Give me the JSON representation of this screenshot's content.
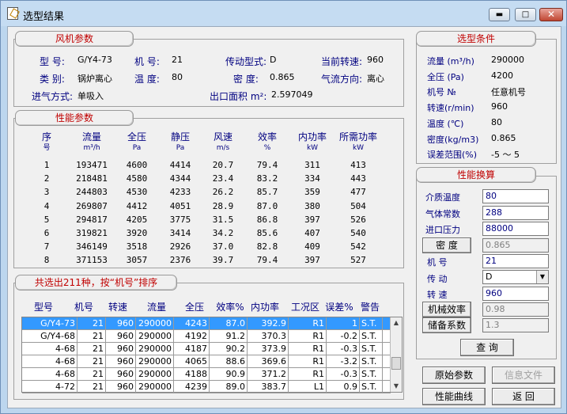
{
  "window": {
    "title": "选型结果",
    "minimize": "▬",
    "maximize": "□",
    "close": "✕"
  },
  "fan_params": {
    "title": "风机参数",
    "rows": [
      [
        {
          "label": "型  号:",
          "value": "G/Y4-73"
        },
        {
          "label": "机  号:",
          "value": "21"
        },
        {
          "label": "传动型式:",
          "value": "D"
        },
        {
          "label": "当前转速:",
          "value": "960"
        }
      ],
      [
        {
          "label": "类  别:",
          "value": "锅炉离心"
        },
        {
          "label": "温  度:",
          "value": "80"
        },
        {
          "label": "密  度:",
          "value": "0.865"
        },
        {
          "label": "气流方向:",
          "value": "离心"
        }
      ],
      [
        {
          "label": "进气方式:",
          "value": "单吸入"
        },
        {
          "label": "出口面积 m²:",
          "value": "2.597049"
        }
      ]
    ]
  },
  "perf_params": {
    "title": "性能参数",
    "headers": [
      [
        "序",
        "号"
      ],
      [
        "流量",
        "m³/h"
      ],
      [
        "全压",
        "Pa"
      ],
      [
        "静压",
        "Pa"
      ],
      [
        "风速",
        "m/s"
      ],
      [
        "效率",
        "%"
      ],
      [
        "内功率",
        "kW"
      ],
      [
        "所需功率",
        "kW"
      ]
    ],
    "rows": [
      [
        "1",
        "193471",
        "4600",
        "4414",
        "20.7",
        "79.4",
        "311",
        "413"
      ],
      [
        "2",
        "218481",
        "4580",
        "4344",
        "23.4",
        "83.2",
        "334",
        "443"
      ],
      [
        "3",
        "244803",
        "4530",
        "4233",
        "26.2",
        "85.7",
        "359",
        "477"
      ],
      [
        "4",
        "269807",
        "4412",
        "4051",
        "28.9",
        "87.0",
        "380",
        "504"
      ],
      [
        "5",
        "294817",
        "4205",
        "3775",
        "31.5",
        "86.8",
        "397",
        "526"
      ],
      [
        "6",
        "319821",
        "3920",
        "3414",
        "34.2",
        "85.6",
        "407",
        "540"
      ],
      [
        "7",
        "346149",
        "3518",
        "2926",
        "37.0",
        "82.8",
        "409",
        "542"
      ],
      [
        "8",
        "371153",
        "3057",
        "2376",
        "39.7",
        "79.4",
        "397",
        "527"
      ]
    ]
  },
  "results": {
    "title": "共选出211种，按“机号”排序",
    "headers": [
      "型号",
      "机号",
      "转速",
      "流量",
      "全压",
      "效率%",
      "内功率",
      "工况区",
      "误差%",
      "警告"
    ],
    "rows": [
      [
        "G/Y4-73",
        "21",
        "960",
        "290000",
        "4243",
        "87.0",
        "392.9",
        "R1",
        "1",
        "S.T."
      ],
      [
        "G/Y4-68",
        "21",
        "960",
        "290000",
        "4192",
        "91.2",
        "370.3",
        "R1",
        "-0.2",
        "S.T."
      ],
      [
        "4-68",
        "21",
        "960",
        "290000",
        "4187",
        "90.2",
        "373.9",
        "R1",
        "-0.3",
        "S.T."
      ],
      [
        "4-68",
        "21",
        "960",
        "290000",
        "4065",
        "88.6",
        "369.6",
        "R1",
        "-3.2",
        "S.T."
      ],
      [
        "4-68",
        "21",
        "960",
        "290000",
        "4188",
        "90.9",
        "371.2",
        "R1",
        "-0.3",
        "S.T."
      ],
      [
        "4-72",
        "21",
        "960",
        "290000",
        "4239",
        "89.0",
        "383.7",
        "L1",
        "0.9",
        "S.T."
      ]
    ]
  },
  "conditions": {
    "title": "选型条件",
    "rows": [
      {
        "label": "流量 (m³/h)",
        "value": "290000"
      },
      {
        "label": "全压  (Pa)",
        "value": "4200"
      },
      {
        "label": "机号    №",
        "value": "任意机号"
      },
      {
        "label": "转速(r/min)",
        "value": "960"
      },
      {
        "label": "温度  (℃)",
        "value": "80"
      },
      {
        "label": "密度(kg/m3)",
        "value": "0.865"
      },
      {
        "label": "误差范围(%)",
        "value": "-5 ～ 5"
      }
    ]
  },
  "conversion": {
    "title": "性能换算",
    "medium_temp": {
      "label": "介质温度",
      "value": "80"
    },
    "gas_const": {
      "label": "气体常数",
      "value": "288"
    },
    "inlet_pressure": {
      "label": "进口压力",
      "value": "88000"
    },
    "density": {
      "label": "密  度",
      "value": "0.865"
    },
    "machine_no": {
      "label": "机    号",
      "value": "21"
    },
    "drive": {
      "label": "传    动",
      "value": "D"
    },
    "speed": {
      "label": "转    速",
      "value": "960"
    },
    "mech_eff": {
      "label": "机械效率",
      "value": "0.98"
    },
    "reserve": {
      "label": "储备系数",
      "value": "1.3"
    },
    "query_button": "查  询"
  },
  "buttons": {
    "raw_params": "原始参数",
    "info_file": "信息文件",
    "perf_curve": "性能曲线",
    "back": "返  回"
  }
}
